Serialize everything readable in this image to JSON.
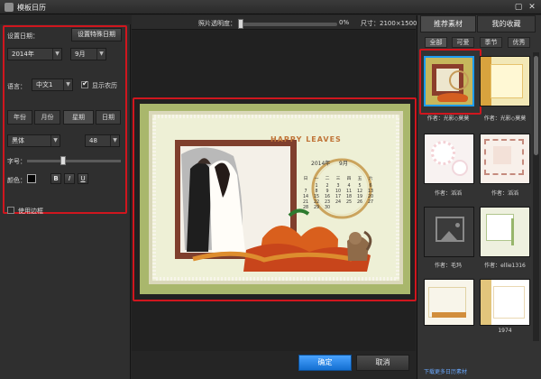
{
  "window": {
    "title": "模板日历"
  },
  "sidebar": {
    "set_date_label": "设置日期：",
    "special_date_button": "设置特殊日期",
    "year": "2014年",
    "month": "9月",
    "language_label": "语言：",
    "language": "中文1",
    "show_lunar_label": "显示农历",
    "segment_tabs": [
      "年份",
      "月份",
      "星期",
      "日期"
    ],
    "font": "黑体",
    "font_size": "48",
    "font_size_label": "字号：",
    "font_size_level": 0.38,
    "color_label": "颜色：",
    "style_buttons": [
      "B",
      "I",
      "U"
    ],
    "use_border_label": "使用边框"
  },
  "toolbar": {
    "transparency_label": "照片透明度：",
    "transparency_value": "0%",
    "size_label": "尺寸：2100×1500"
  },
  "calendar_preview": {
    "title_text": "2014年",
    "month_text": "9月",
    "weekdays": [
      "日",
      "一",
      "二",
      "三",
      "四",
      "五",
      "六"
    ],
    "days": [
      "1",
      "2",
      "3",
      "4",
      "5",
      "6",
      "7",
      "8",
      "9",
      "10",
      "11",
      "12",
      "13",
      "14",
      "15",
      "16",
      "17",
      "18",
      "19",
      "20",
      "21",
      "22",
      "23",
      "24",
      "25",
      "26",
      "27",
      "28",
      "29",
      "30"
    ],
    "decor_text": "HAPPY LEAVES"
  },
  "rightpanel": {
    "tabs": [
      "推荐素材",
      "我的收藏"
    ],
    "subtabs": [
      "全部",
      "可爱",
      "季节",
      "优秀"
    ],
    "thumbnails": [
      {
        "caption": "作者：光影◇莫莫",
        "variant": "autumn-selected"
      },
      {
        "caption": "作者：光影◇莫莫",
        "variant": "yellow-floral"
      },
      {
        "caption": "作者：滔滔",
        "variant": "white-lace"
      },
      {
        "caption": "作者：滔滔",
        "variant": "pink-border"
      },
      {
        "caption": "作者：毛玛",
        "variant": "placeholder"
      },
      {
        "caption": "作者：ellie1316",
        "variant": "light-vine"
      },
      {
        "caption": "",
        "variant": "autumn-light"
      },
      {
        "caption": "1974",
        "variant": "floral-edge"
      }
    ],
    "more_link": "下载更多日历素材"
  },
  "bottom": {
    "confirm_label": "确定",
    "cancel_label": "取消"
  }
}
